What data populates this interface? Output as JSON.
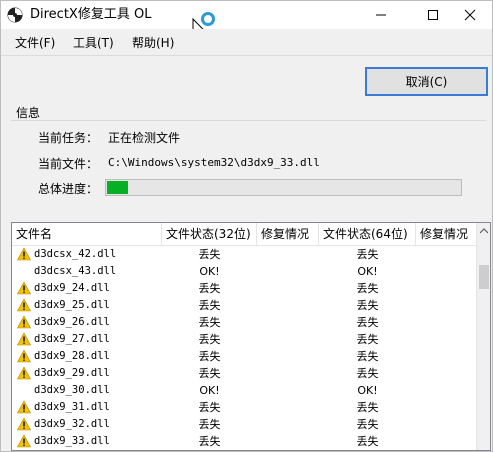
{
  "window": {
    "title": "DirectX修复工具 OL"
  },
  "menu": [
    {
      "label": "文件(F)"
    },
    {
      "label": "工具(T)"
    },
    {
      "label": "帮助(H)"
    }
  ],
  "actions": {
    "cancel_label": "取消(C)"
  },
  "info": {
    "section_title": "信息",
    "current_task_label": "当前任务：",
    "current_task_value": "正在检测文件",
    "current_file_label": "当前文件：",
    "current_file_value": "C:\\Windows\\system32\\d3dx9_33.dll",
    "progress_label": "总体进度：",
    "progress_fraction": 0.06,
    "progress_color": "#06b025"
  },
  "table": {
    "headers": [
      "文件名",
      "文件状态(32位)",
      "修复情况",
      "文件状态(64位)",
      "修复情况"
    ],
    "rows": [
      {
        "warn": true,
        "name": "d3dcsx_42.dll",
        "s32": "丢失",
        "r32": "",
        "s64": "丢失",
        "r64": ""
      },
      {
        "warn": false,
        "name": "d3dcsx_43.dll",
        "s32": "OK!",
        "r32": "",
        "s64": "OK!",
        "r64": ""
      },
      {
        "warn": true,
        "name": "d3dx9_24.dll",
        "s32": "丢失",
        "r32": "",
        "s64": "丢失",
        "r64": ""
      },
      {
        "warn": true,
        "name": "d3dx9_25.dll",
        "s32": "丢失",
        "r32": "",
        "s64": "丢失",
        "r64": ""
      },
      {
        "warn": true,
        "name": "d3dx9_26.dll",
        "s32": "丢失",
        "r32": "",
        "s64": "丢失",
        "r64": ""
      },
      {
        "warn": true,
        "name": "d3dx9_27.dll",
        "s32": "丢失",
        "r32": "",
        "s64": "丢失",
        "r64": ""
      },
      {
        "warn": true,
        "name": "d3dx9_28.dll",
        "s32": "丢失",
        "r32": "",
        "s64": "丢失",
        "r64": ""
      },
      {
        "warn": true,
        "name": "d3dx9_29.dll",
        "s32": "丢失",
        "r32": "",
        "s64": "丢失",
        "r64": ""
      },
      {
        "warn": false,
        "name": "d3dx9_30.dll",
        "s32": "OK!",
        "r32": "",
        "s64": "OK!",
        "r64": ""
      },
      {
        "warn": true,
        "name": "d3dx9_31.dll",
        "s32": "丢失",
        "r32": "",
        "s64": "丢失",
        "r64": ""
      },
      {
        "warn": true,
        "name": "d3dx9_32.dll",
        "s32": "丢失",
        "r32": "",
        "s64": "丢失",
        "r64": ""
      },
      {
        "warn": true,
        "name": "d3dx9_33.dll",
        "s32": "丢失",
        "r32": "",
        "s64": "丢失",
        "r64": ""
      }
    ]
  },
  "icons": {
    "app": "app-icon",
    "warning": "warning-icon",
    "loading": "loading-icon",
    "cursor": "cursor-icon"
  }
}
